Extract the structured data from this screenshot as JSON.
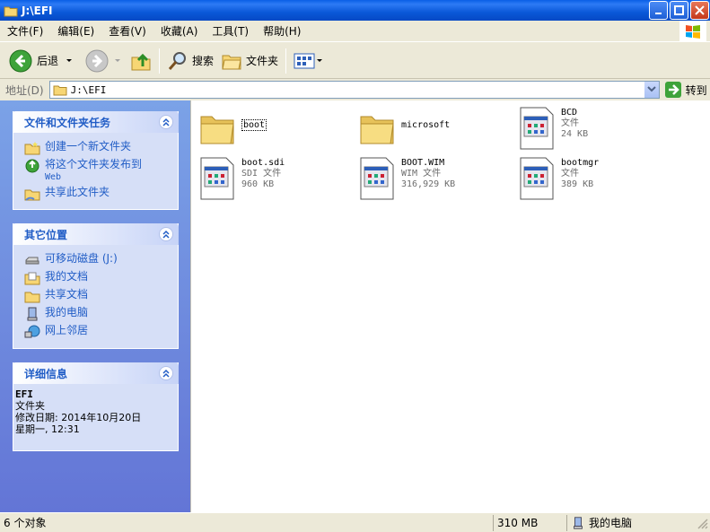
{
  "window": {
    "title": "J:\\EFI"
  },
  "menu": [
    "文件(F)",
    "编辑(E)",
    "查看(V)",
    "收藏(A)",
    "工具(T)",
    "帮助(H)"
  ],
  "toolbar": {
    "back": "后退",
    "search": "搜索",
    "folders": "文件夹"
  },
  "address": {
    "label": "地址(D)",
    "value": "J:\\EFI",
    "go": "转到"
  },
  "panels": {
    "tasks": {
      "title": "文件和文件夹任务",
      "items": [
        "创建一个新文件夹",
        "将这个文件夹发布到",
        "Web",
        "共享此文件夹"
      ]
    },
    "places": {
      "title": "其它位置",
      "items": [
        "可移动磁盘 (J:)",
        "我的文档",
        "共享文档",
        "我的电脑",
        "网上邻居"
      ]
    },
    "details": {
      "title": "详细信息",
      "name": "EFI",
      "type": "文件夹",
      "modified": "修改日期: 2014年10月20日",
      "modified2": "星期一, 12:31"
    }
  },
  "files": [
    {
      "name": "boot",
      "kind": "folder"
    },
    {
      "name": "microsoft",
      "kind": "folder"
    },
    {
      "name": "BCD",
      "type": "文件",
      "size": "24 KB",
      "kind": "file"
    },
    {
      "name": "boot.sdi",
      "type": "SDI 文件",
      "size": "960 KB",
      "kind": "file"
    },
    {
      "name": "BOOT.WIM",
      "type": "WIM 文件",
      "size": "316,929 KB",
      "kind": "file"
    },
    {
      "name": "bootmgr",
      "type": "文件",
      "size": "389 KB",
      "kind": "file"
    }
  ],
  "status": {
    "count": "6 个对象",
    "size": "310 MB",
    "location": "我的电脑"
  },
  "colors": {
    "title_bar": "#0a58d8",
    "task_link": "#215dc6",
    "left_pane": "#7ba2e7"
  }
}
